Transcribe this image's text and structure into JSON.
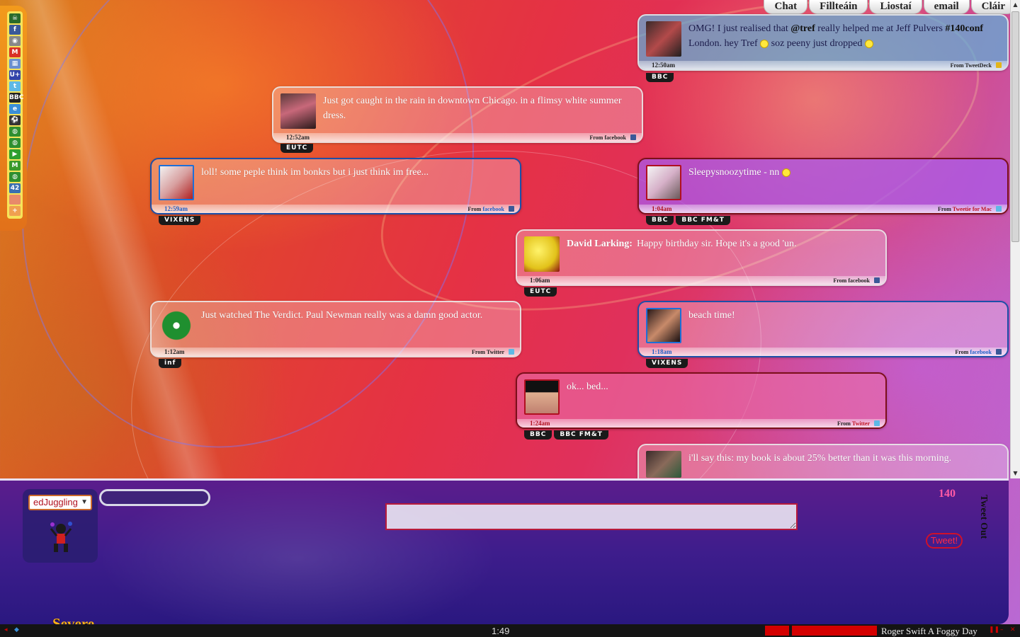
{
  "toolbar_icons": [
    {
      "name": "skull-icon",
      "glyph": "☠",
      "color": "#2a6a2a"
    },
    {
      "name": "facebook-icon",
      "glyph": "f",
      "color": "#3b5998"
    },
    {
      "name": "circle-icon",
      "glyph": "◉",
      "color": "#888888"
    },
    {
      "name": "gmail-icon",
      "glyph": "M",
      "color": "#d93025"
    },
    {
      "name": "calendar-icon",
      "glyph": "▦",
      "color": "#6a8fd0"
    },
    {
      "name": "uplus-icon",
      "glyph": "U+",
      "color": "#3344aa"
    },
    {
      "name": "twitter-icon",
      "glyph": "t",
      "color": "#5eb9e6"
    },
    {
      "name": "bbc-icon",
      "glyph": "BBC",
      "color": "#222222"
    },
    {
      "name": "ie-icon",
      "glyph": "e",
      "color": "#3a8fd8"
    },
    {
      "name": "soccer-icon",
      "glyph": "⚽",
      "color": "#333333"
    },
    {
      "name": "globe-icon",
      "glyph": "◍",
      "color": "#2f8f2f"
    },
    {
      "name": "globe-2-icon",
      "glyph": "◍",
      "color": "#2f8f2f"
    },
    {
      "name": "play-icon",
      "glyph": "▶",
      "color": "#2f9f2f"
    },
    {
      "name": "m-icon",
      "glyph": "M",
      "color": "#3a9a2a"
    },
    {
      "name": "globe-3-icon",
      "glyph": "◍",
      "color": "#2f8f2f"
    },
    {
      "name": "calendar-42-icon",
      "glyph": "42",
      "color": "#3a6fb0"
    },
    {
      "name": "blank-icon",
      "glyph": "",
      "color": "#e88a6a"
    },
    {
      "name": "add-icon",
      "glyph": "+",
      "color": "#f0a050"
    }
  ],
  "nav": {
    "chat": "Chat",
    "filltean": "Fillteáin",
    "liostai": "Liostaí",
    "email": "email",
    "clair": "Cláir"
  },
  "tweets": [
    {
      "text_pre": "OMG! I just realised that ",
      "tag1": "@tref",
      "text_mid": " really helped me at Jeff Pulvers ",
      "tag2": "#140conf",
      "text_post": " London. hey Tref ",
      "text_end": " soz peeny just dropped ",
      "time": "12:50am",
      "src_prefix": "From ",
      "src": "TweetDeck",
      "badges": [
        "BBC"
      ]
    },
    {
      "text": "Just got caught in the rain in downtown Chicago. in a flimsy white summer dress.",
      "time": "12:52am",
      "src_prefix": "From ",
      "src": "facebook",
      "badges": [
        "EUTC"
      ]
    },
    {
      "text": "loll! some peple think im bonkrs but i just think im free...",
      "time": "12:59am",
      "src_prefix": "From ",
      "src": "facebook",
      "badges": [
        "VIXENS"
      ]
    },
    {
      "text": "Sleepysnoozytime - nn ",
      "time": "1:04am",
      "src_prefix": "From ",
      "src": "Tweetie for Mac",
      "badges": [
        "BBC",
        "BBC FM&T"
      ]
    },
    {
      "author": "David Larking:",
      "text": "Happy birthday sir. Hope it's a good 'un.",
      "time": "1:06am",
      "src_prefix": "From ",
      "src": "facebook",
      "badges": [
        "EUTC"
      ]
    },
    {
      "text": "Just watched The Verdict. Paul Newman really was a damn good actor.",
      "time": "1:12am",
      "src_prefix": "From ",
      "src": "Twitter",
      "badges": [
        "inf"
      ]
    },
    {
      "text": "beach time!",
      "time": "1:18am",
      "src_prefix": "From ",
      "src": "facebook",
      "badges": [
        "VIXENS"
      ]
    },
    {
      "text": "ok... bed...",
      "time": "1:24am",
      "src_prefix": "From ",
      "src": "Twitter",
      "badges": [
        "BBC",
        "BBC FM&T"
      ]
    },
    {
      "text": "i'll say this: my book is about 25% better than it was this morning."
    }
  ],
  "compose": {
    "account": "edJuggling",
    "char_count": "140",
    "tweet_out_label": "Tweet Out",
    "tweet_button": "Tweet!",
    "weather": "Severe"
  },
  "status_bar": {
    "clock": "1:49",
    "now_playing": "Roger Swift A Foggy Day"
  }
}
